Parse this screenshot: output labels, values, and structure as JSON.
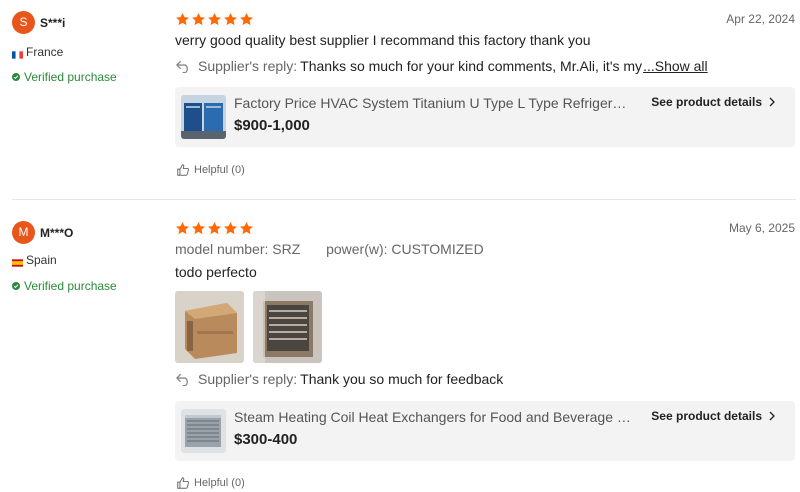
{
  "reviews": [
    {
      "avatar_letter": "S",
      "username": "S***i",
      "country": "France",
      "verified_label": "Verified purchase",
      "date": "Apr 22, 2024",
      "rating": 5,
      "text": "verry good quality best supplier I recommand this factory thank you",
      "reply_label": "Supplier's reply:",
      "reply_text": "Thanks so much for your kind comments, Mr.Ali, it's my ",
      "reply_more": "...Show all",
      "product_title": "Factory Price HVAC System Titanium U Type L Type Refrigeration Heat Exchanger",
      "product_price": "$900-1,000",
      "product_link": "See product details",
      "helpful_label": "Helpful (0)"
    },
    {
      "avatar_letter": "M",
      "username": "M***O",
      "country": "Spain",
      "verified_label": "Verified purchase",
      "date": "May 6, 2025",
      "rating": 5,
      "attr1_name": "model number",
      "attr1_value": "SRZ",
      "attr2_name": "power(w)",
      "attr2_value": "CUSTOMIZED",
      "text": "todo perfecto",
      "reply_label": "Supplier's reply:",
      "reply_text": "Thank you so much for feedback",
      "product_title": "Steam Heating Coil Heat Exchangers for Food and Beverage Industry",
      "product_price": "$300-400",
      "product_link": "See product details",
      "helpful_label": "Helpful (0)"
    }
  ],
  "colors": {
    "star": "#ff6a00",
    "avatar": "#e8561b",
    "verified": "#2a8a3a"
  }
}
